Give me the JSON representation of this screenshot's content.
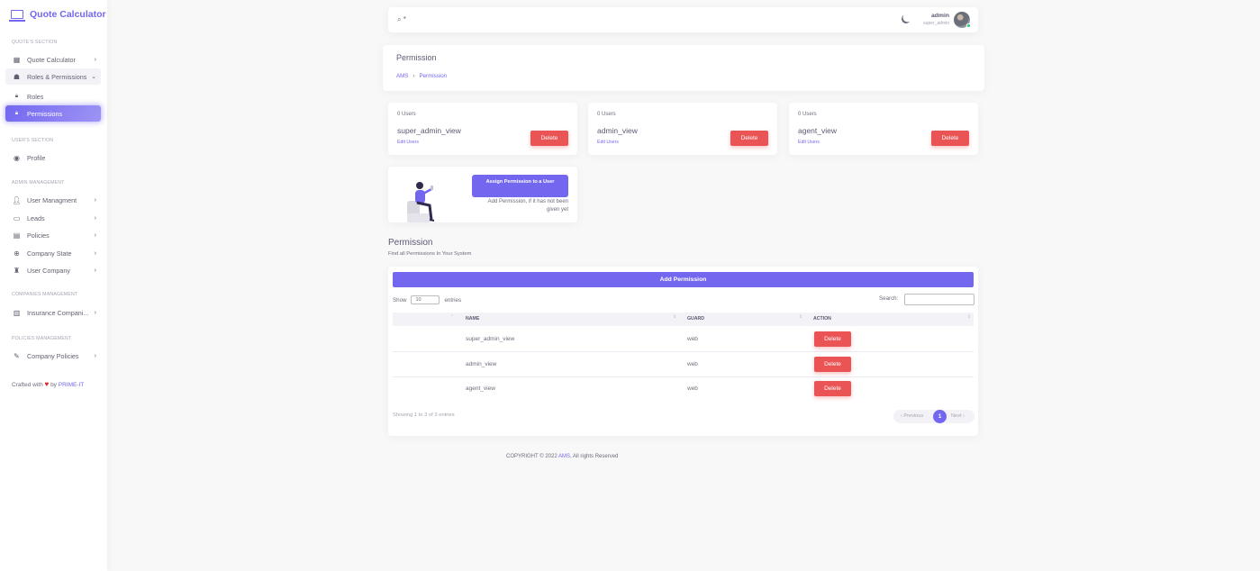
{
  "brand": {
    "name": "Quote Calculator",
    "color": "#7367f0"
  },
  "sidebar": {
    "sections": {
      "quote": "QUOTE'S SECTION",
      "users": "USER'S SECTION",
      "admin": "ADMIN MANAGEMENT",
      "companies": "COMPANIES MANAGEMENT",
      "policies": "POLICIES MANAGEMENT"
    },
    "items": {
      "quote_calculator": "Quote Calculator",
      "roles_permissions": "Roles & Permissions",
      "roles": "Roles",
      "permissions": "Permissions",
      "profile": "Profile",
      "user_management": "User Managment",
      "leads": "Leads",
      "policies": "Policies",
      "company_state": "Company State",
      "user_company": "User Company",
      "insurance_companies": "Insurance Compani...",
      "company_policies": "Company Policies"
    },
    "crafted": {
      "prefix": "Crafted with",
      "by": "by",
      "link": "PRIME-IT"
    }
  },
  "navbar": {
    "search_text": "*",
    "user_name": "admin",
    "user_role": "super_admin"
  },
  "header": {
    "title": "Permission",
    "breadcrumb": [
      "AMS",
      "Permission"
    ]
  },
  "cards": [
    {
      "users": "0 Users",
      "name": "super_admin_view",
      "edit": "Edit Users",
      "delete": "Delete"
    },
    {
      "users": "0 Users",
      "name": "admin_view",
      "edit": "Edit Users",
      "delete": "Delete"
    },
    {
      "users": "0 Users",
      "name": "agent_view",
      "edit": "Edit Users",
      "delete": "Delete"
    }
  ],
  "assign": {
    "button": "Assign Permission to a User",
    "text": "Add Permission, if it has not been given yet"
  },
  "permission_section": {
    "title": "Permission",
    "subtitle": "Find all Permissions In Your System"
  },
  "table": {
    "add_button": "Add Permission",
    "show_label": "Show",
    "entries_value": "10",
    "entries_label": "entries",
    "search_label": "Search:",
    "columns": [
      "NAME",
      "GUARD",
      "ACTION"
    ],
    "rows": [
      {
        "name": "super_admin_view",
        "guard": "web",
        "action": "Delete"
      },
      {
        "name": "admin_view",
        "guard": "web",
        "action": "Delete"
      },
      {
        "name": "agent_view",
        "guard": "web",
        "action": "Delete"
      }
    ],
    "info": "Showing 1 to 3 of 3 entries",
    "pagination": {
      "previous": "Previous",
      "page": "1",
      "next": "Next"
    }
  },
  "footer": {
    "prefix": "COPYRIGHT © 2022",
    "link": "AMS",
    "suffix": ", All rights Reserved"
  }
}
